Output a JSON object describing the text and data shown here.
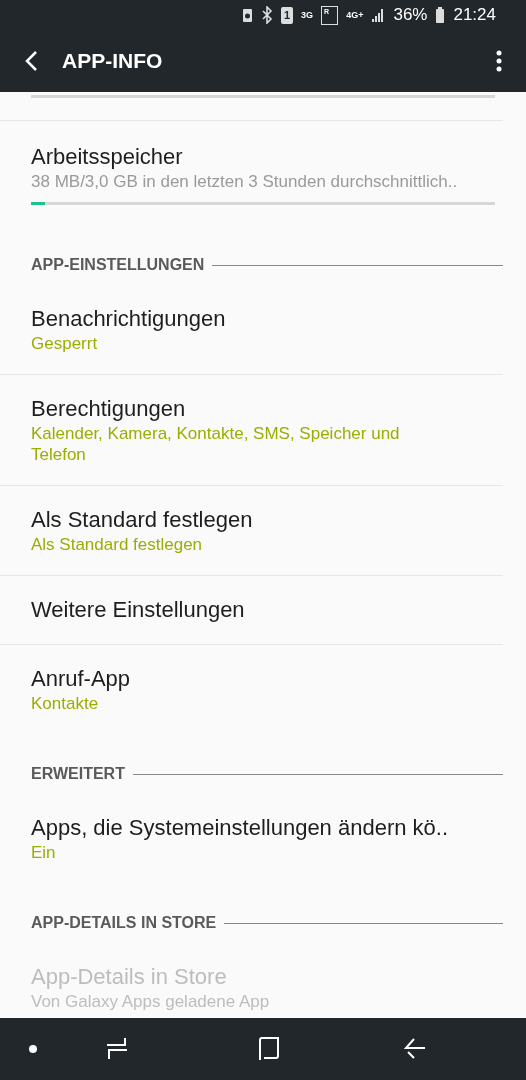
{
  "status_bar": {
    "sim_slot": "1",
    "network_1": "3G",
    "roaming": "R",
    "network_2": "4G+",
    "battery": "36%",
    "time": "21:24"
  },
  "app_bar": {
    "title": "APP-INFO"
  },
  "items": [
    {
      "kind": "bar"
    },
    {
      "kind": "usage",
      "title": "Arbeitsspeicher",
      "summary": "38 MB/3,0 GB in den letzten 3 Stunden durchschnittlich..",
      "level": 0.03
    },
    {
      "kind": "header",
      "title": "APP-EINSTELLUNGEN"
    },
    {
      "kind": "setting",
      "title": "Benachrichtigungen",
      "summary": "Gesperrt",
      "disabled": false
    },
    {
      "kind": "setting",
      "title": "Berechtigungen",
      "summary": "Kalender, Kamera, Kontakte, SMS, Speicher und Telefon",
      "disabled": false
    },
    {
      "kind": "setting",
      "title": "Als Standard festlegen",
      "summary": "Als Standard festlegen",
      "disabled": false
    },
    {
      "kind": "setting",
      "title": "Weitere Einstellungen",
      "disabled": false
    },
    {
      "kind": "setting",
      "title": "Anruf-App",
      "summary": "Kontakte",
      "disabled": false
    },
    {
      "kind": "header",
      "title": "ERWEITERT"
    },
    {
      "kind": "setting",
      "title": "Apps, die Systemeinstellungen ändern kö..",
      "summary": "Ein",
      "disabled": false
    },
    {
      "kind": "header",
      "title": "APP-DETAILS IN STORE"
    },
    {
      "kind": "setting",
      "title": "App-Details in Store",
      "summary": "Von Galaxy Apps geladene App",
      "disabled": true
    }
  ]
}
